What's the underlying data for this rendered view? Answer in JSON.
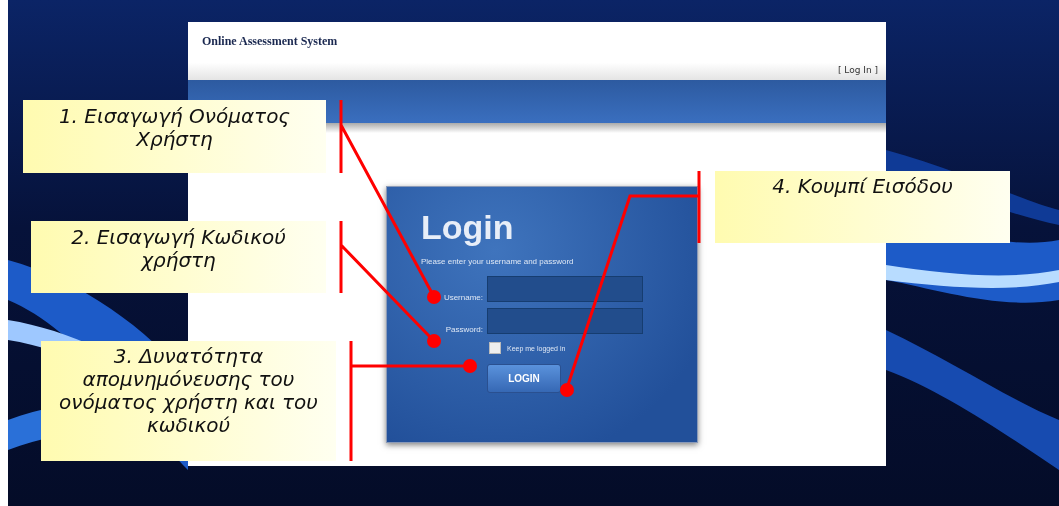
{
  "app": {
    "title": "Online Assessment System",
    "login_link": "[ Log In ]"
  },
  "login_panel": {
    "heading": "Login",
    "instructions": "Please enter your username and password",
    "fields": [
      {
        "label": "Username:"
      },
      {
        "label": "Password:"
      }
    ],
    "remember": {
      "label": "Keep me logged in",
      "checked": false
    },
    "button": "LOGIN"
  },
  "callouts": [
    {
      "text": "1. Εισαγωγή Ονόματος Χρήστη"
    },
    {
      "text": "2. Εισαγωγή Κωδικού χρήστη"
    },
    {
      "text": "3. Δυνατότητα απομνημόνευσης του ονόματος χρήστη και του κωδικού"
    },
    {
      "text": "4. Κουμπί Εισόδου"
    }
  ]
}
